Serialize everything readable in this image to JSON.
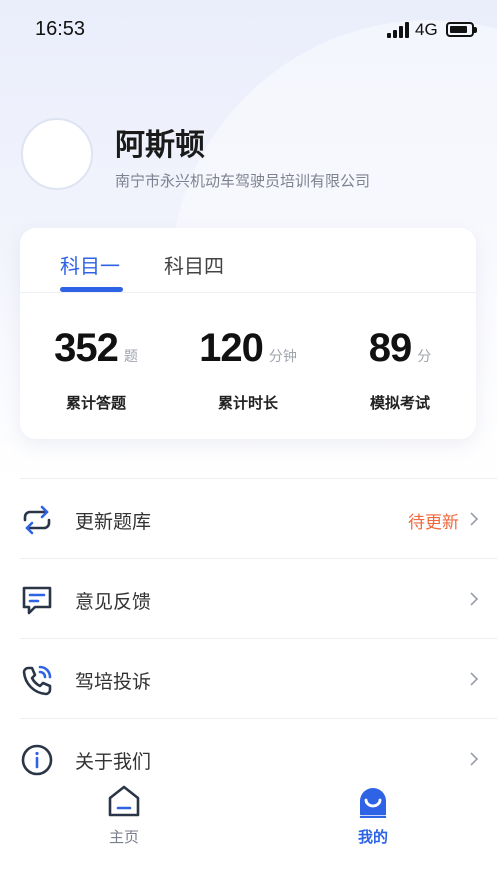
{
  "status_bar": {
    "time": "16:53",
    "network": "4G",
    "battery_level": 0.85
  },
  "profile": {
    "name": "阿斯顿",
    "organization": "南宁市永兴机动车驾驶员培训有限公司"
  },
  "tabs": [
    {
      "label": "科目一",
      "active": true
    },
    {
      "label": "科目四",
      "active": false
    }
  ],
  "stats": [
    {
      "value": "352",
      "unit": "题",
      "label": "累计答题"
    },
    {
      "value": "120",
      "unit": "分钟",
      "label": "累计时长"
    },
    {
      "value": "89",
      "unit": "分",
      "label": "模拟考试"
    }
  ],
  "menu": [
    {
      "label": "更新题库",
      "status": "待更新",
      "icon": "refresh-icon"
    },
    {
      "label": "意见反馈",
      "status": "",
      "icon": "feedback-icon"
    },
    {
      "label": "驾培投诉",
      "status": "",
      "icon": "phone-complaint-icon"
    },
    {
      "label": "关于我们",
      "status": "",
      "icon": "info-icon"
    }
  ],
  "bottom_nav": [
    {
      "label": "主页",
      "icon": "home-icon",
      "active": false
    },
    {
      "label": "我的",
      "icon": "profile-face-icon",
      "active": true
    }
  ],
  "colors": {
    "accent": "#2f63e6",
    "warning": "#f0683c"
  }
}
